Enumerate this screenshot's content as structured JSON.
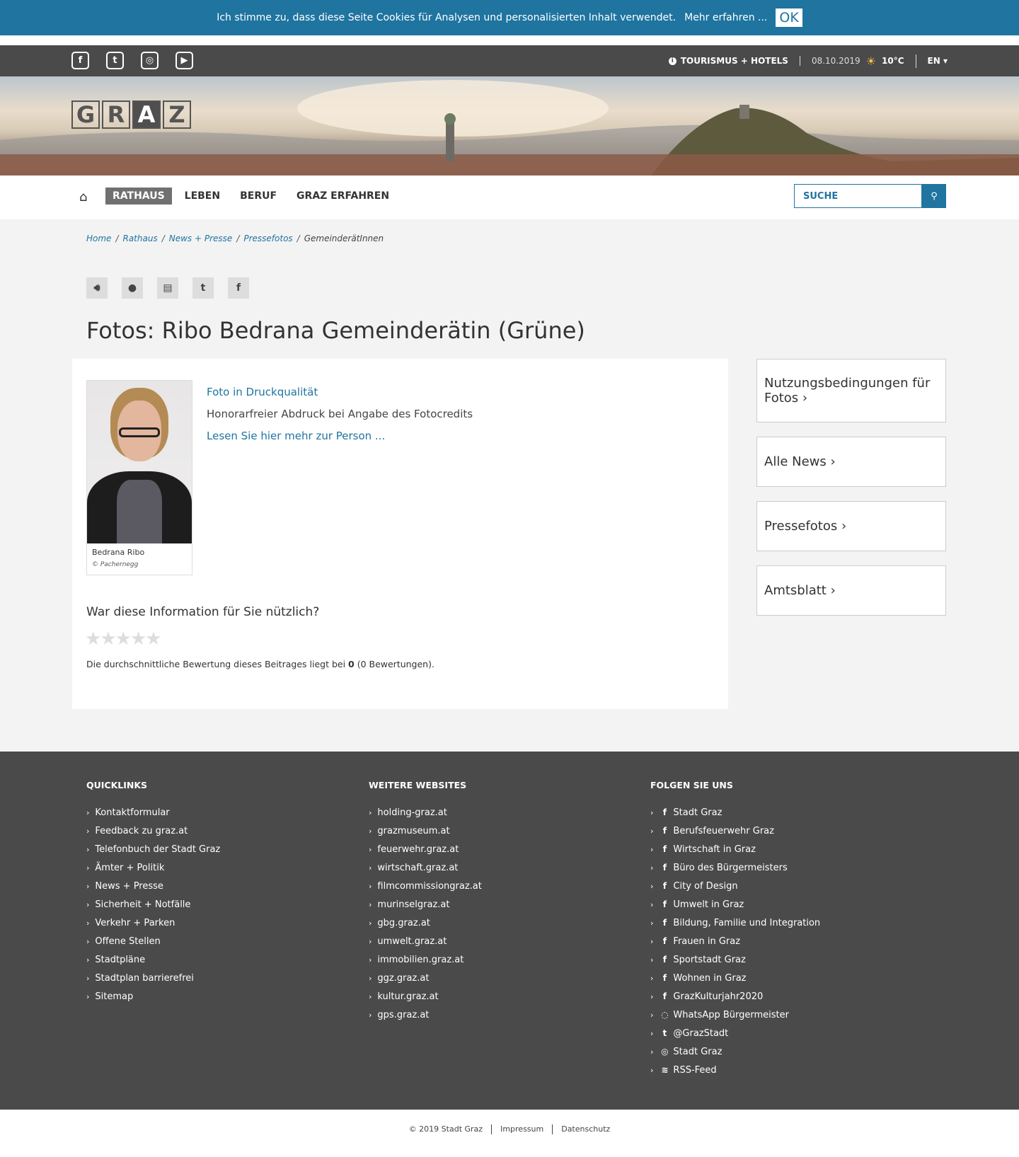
{
  "cookie": {
    "text": "Ich stimme zu, dass diese Seite Cookies für Analysen und personalisierten Inhalt verwendet.",
    "more": "Mehr erfahren ...",
    "ok": "OK"
  },
  "topbar": {
    "social_icons": [
      "facebook-icon",
      "twitter-icon",
      "instagram-icon",
      "youtube-icon"
    ],
    "tourism": "TOURISMUS + HOTELS",
    "date": "08.10.2019",
    "temperature": "10°C",
    "language": "EN"
  },
  "logo": {
    "letters": [
      "G",
      "R",
      "A",
      "Z"
    ]
  },
  "nav": {
    "items": [
      "RATHAUS",
      "LEBEN",
      "BERUF",
      "GRAZ ERFAHREN"
    ],
    "active": "RATHAUS",
    "search_placeholder": "SUCHE"
  },
  "breadcrumb": {
    "home": "Home",
    "rathaus": "Rathaus",
    "news": "News + Presse",
    "pressefotos": "Pressefotos",
    "current": "GemeinderätInnen"
  },
  "title": "Fotos: Ribo Bedrana Gemeinderätin (Grüne)",
  "photo": {
    "caption": "Bedrana Ribo",
    "credit": "© Pachernegg"
  },
  "details": {
    "download": "Foto in Druckqualität",
    "info": "Honorarfreier Abdruck bei Angabe des Fotocredits",
    "more": "Lesen Sie hier mehr zur Person ..."
  },
  "rating": {
    "question": "War diese Information für Sie nützlich?",
    "summary_prefix": "Die durchschnittliche Bewertung dieses Beitrages liegt bei ",
    "average": "0",
    "summary_suffix": " (0 Bewertungen).",
    "stars_total": 5,
    "stars_filled": 0
  },
  "sidebar": {
    "box1": "Nutzungsbedingungen für Fotos",
    "box2": "Alle News",
    "box3": "Pressefotos",
    "box4": "Amtsblatt"
  },
  "footer": {
    "quicklinks": {
      "title": "QUICKLINKS",
      "items": [
        "Kontaktformular",
        "Feedback zu graz.at",
        "Telefonbuch der Stadt Graz",
        "Ämter + Politik",
        "News + Presse",
        "Sicherheit + Notfälle",
        "Verkehr + Parken",
        "Offene Stellen",
        "Stadtpläne",
        "Stadtplan barrierefrei",
        "Sitemap"
      ]
    },
    "websites": {
      "title": "WEITERE WEBSITES",
      "items": [
        "holding-graz.at",
        "grazmuseum.at",
        "feuerwehr.graz.at",
        "wirtschaft.graz.at",
        "filmcommissiongraz.at",
        "murinselgraz.at",
        "gbg.graz.at",
        "umwelt.graz.at",
        "immobilien.graz.at",
        "ggz.graz.at",
        "kultur.graz.at",
        "gps.graz.at"
      ]
    },
    "follow": {
      "title": "FOLGEN SIE UNS",
      "items": [
        "Stadt Graz",
        "Berufsfeuerwehr Graz",
        "Wirtschaft in Graz",
        "Büro des Bürgermeisters",
        "City of Design",
        "Umwelt in Graz",
        "Bildung, Familie und Integration",
        "Frauen in Graz",
        "Sportstadt Graz",
        "Wohnen in Graz",
        "GrazKulturjahr2020",
        "WhatsApp Bürgermeister",
        "@GrazStadt",
        "Stadt Graz",
        "RSS-Feed"
      ],
      "icons": [
        "facebook-icon",
        "facebook-icon",
        "facebook-icon",
        "facebook-icon",
        "facebook-icon",
        "facebook-icon",
        "facebook-icon",
        "facebook-icon",
        "facebook-icon",
        "facebook-icon",
        "facebook-icon",
        "whatsapp-icon",
        "twitter-icon",
        "instagram-icon",
        "rss-icon"
      ]
    }
  },
  "bottom": {
    "copyright": "© 2019 Stadt Graz",
    "impressum": "Impressum",
    "datenschutz": "Datenschutz"
  }
}
